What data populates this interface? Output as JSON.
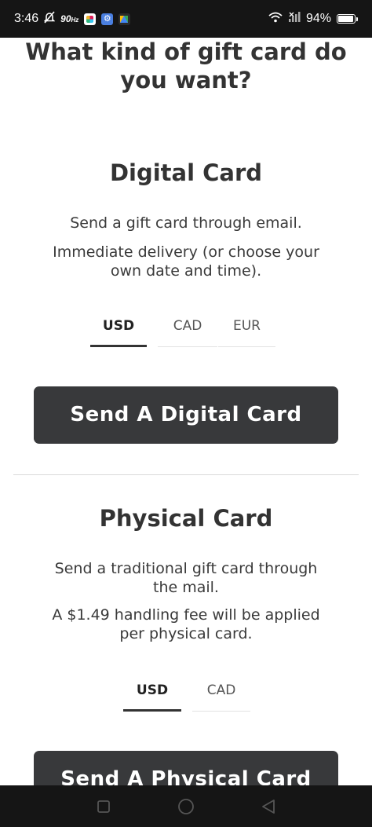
{
  "status_bar": {
    "time": "3:46",
    "refresh_rate": "90",
    "refresh_unit": "Hz",
    "battery": "94%",
    "icons": [
      "mute-icon",
      "slack-icon",
      "gear-icon",
      "drive-icon",
      "wifi-icon",
      "signal-icon",
      "battery-icon"
    ]
  },
  "page": {
    "title_line1": "What kind of gift card do",
    "title_line2": "you want?"
  },
  "digital": {
    "title": "Digital Card",
    "desc1": "Send a gift card through email.",
    "desc2_line1": "Immediate delivery (or choose your",
    "desc2_line2": "own date and time).",
    "tabs": [
      {
        "label": "USD",
        "active": true
      },
      {
        "label": "CAD",
        "active": false
      },
      {
        "label": "EUR",
        "active": false
      }
    ],
    "button": "Send A Digital Card"
  },
  "physical": {
    "title": "Physical Card",
    "desc1_line1": "Send a traditional gift card through",
    "desc1_line2": "the mail.",
    "desc2_line1": "A $1.49 handling fee will be applied",
    "desc2_line2": "per physical card.",
    "tabs": [
      {
        "label": "USD",
        "active": true
      },
      {
        "label": "CAD",
        "active": false
      }
    ],
    "button": "Send A Physical Card"
  },
  "colors": {
    "button_bg": "#38393b",
    "text": "#333333",
    "status_bg": "#151515"
  }
}
